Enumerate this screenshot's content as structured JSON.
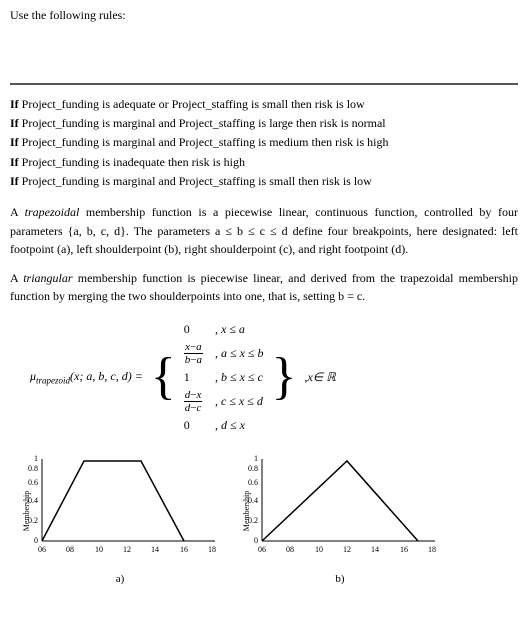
{
  "header": {
    "text": "Use the following rules:"
  },
  "rules": [
    "If Project_funding is adequate or Project_staffing is small then risk is low",
    "If Project_funding is marginal and Project_staffing is large then risk is normal",
    "If Project_funding is marginal and Project_staffing is medium then risk is high",
    "If Project_funding is inadequate then risk is high",
    "If Project_funding is marginal and Project_staffing is small then risk is low"
  ],
  "para1": "A trapezoidal membership function is a piecewise linear, continuous function, controlled by four parameters {a, b, c, d}. The parameters a ≤ b ≤ c ≤ d define four breakpoints, here designated: left footpoint (a), left shoulderpoint (b), right shoulderpoint (c), and right footpoint (d).",
  "para2": "A triangular membership function is piecewise linear, and derived from the trapezoidal membership function by merging the two shoulderpoints into one, that is, setting b = c.",
  "formula_lhs": "μtrapezoid(x; a, b, c, d) =",
  "cases": [
    {
      "val": "0",
      "cond": ", x ≤ a"
    },
    {
      "val": "x−a/b−a",
      "cond": ", a ≤ x ≤ b"
    },
    {
      "val": "1",
      "cond": ", b ≤ x ≤ c"
    },
    {
      "val": "d−x/d−c",
      "cond": ", c ≤ x ≤ d"
    },
    {
      "val": "0",
      "cond": ", d ≤ x"
    }
  ],
  "domain": ", x ∈ ℝ",
  "chart_a": {
    "label": "a)",
    "x_ticks": [
      "06",
      "08",
      "10",
      "12",
      "14",
      "16",
      "18"
    ],
    "shape": "trapezoid",
    "points": [
      6,
      9,
      13,
      16
    ]
  },
  "chart_b": {
    "label": "b)",
    "x_ticks": [
      "06",
      "08",
      "10",
      "12",
      "14",
      "16",
      "18"
    ],
    "shape": "triangle",
    "points": [
      6,
      12,
      12,
      17
    ]
  }
}
